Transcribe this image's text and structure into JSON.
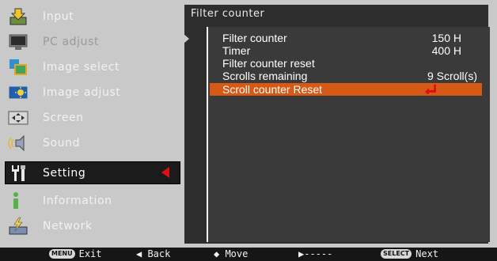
{
  "sidebar": {
    "items": [
      {
        "label": "Input",
        "icon": "input-arrow-icon",
        "state": "normal"
      },
      {
        "label": "PC adjust",
        "icon": "pc-monitor-icon",
        "state": "disabled"
      },
      {
        "label": "Image select",
        "icon": "image-select-icon",
        "state": "normal"
      },
      {
        "label": "Image adjust",
        "icon": "image-adjust-icon",
        "state": "normal"
      },
      {
        "label": "Screen",
        "icon": "screen-icon",
        "state": "normal"
      },
      {
        "label": "Sound",
        "icon": "speaker-icon",
        "state": "normal"
      },
      {
        "label": "Setting",
        "icon": "wrench-icon",
        "state": "selected"
      },
      {
        "label": "Information",
        "icon": "info-icon",
        "state": "normal"
      },
      {
        "label": "Network",
        "icon": "network-icon",
        "state": "normal"
      }
    ]
  },
  "panel": {
    "title": "Filter counter",
    "rows": [
      {
        "label": "Filter counter",
        "value": "150 H"
      },
      {
        "label": "Timer",
        "value": "400 H"
      },
      {
        "label": "Filter counter reset",
        "value": ""
      },
      {
        "label": "Scrolls remaining",
        "value": "9 Scroll(s)"
      },
      {
        "label": "Scroll counter Reset",
        "value": "",
        "selected": true
      }
    ]
  },
  "statusbar": {
    "exit_key": "MENU",
    "exit_label": "Exit",
    "back_label": "◀ Back",
    "move_label": "◆ Move",
    "right_label": "▶-----",
    "next_key": "SELECT",
    "next_label": "Next"
  },
  "colors": {
    "background": "#c9c9c9",
    "panel": "#2d2d2d",
    "highlight": "#d65a16",
    "selector_arrow": "#e01010"
  }
}
